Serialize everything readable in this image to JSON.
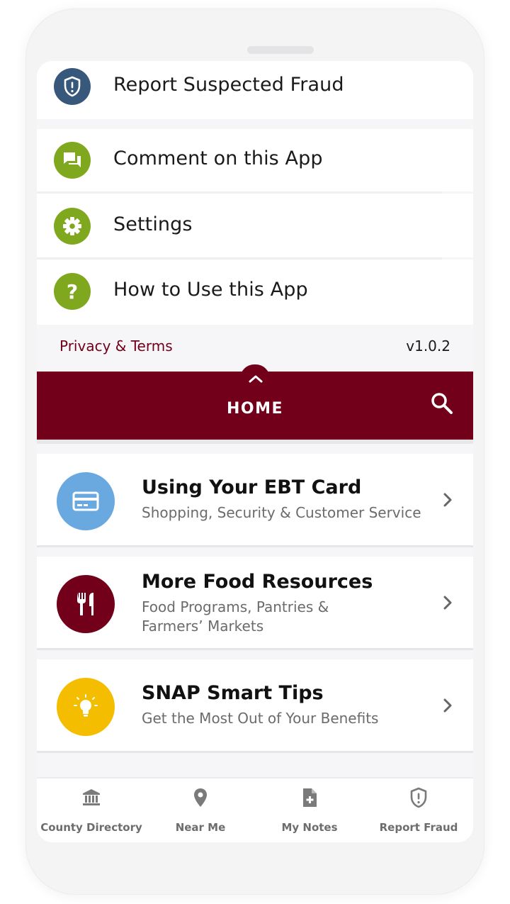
{
  "drawer": {
    "items": [
      {
        "label": "Report Suspected Fraud",
        "icon": "shield-alert-icon",
        "color": "#37587a"
      },
      {
        "label": "Comment on this App",
        "icon": "chat-icon",
        "color": "#7fa81e"
      },
      {
        "label": "Settings",
        "icon": "gear-icon",
        "color": "#7fa81e"
      },
      {
        "label": "How to Use this App",
        "icon": "question-icon",
        "color": "#7fa81e"
      }
    ],
    "privacy_label": "Privacy & Terms",
    "version": "v1.0.2"
  },
  "home_bar": {
    "title": "HOME",
    "color": "#72001a"
  },
  "cards": [
    {
      "title": "Using Your EBT Card",
      "subtitle": "Shopping, Security & Customer Service",
      "icon": "credit-card-icon",
      "color": "#6aa8e0"
    },
    {
      "title": "More Food Resources",
      "subtitle": "Food Programs, Pantries & Farmers’ Markets",
      "icon": "fork-knife-icon",
      "color": "#72001a"
    },
    {
      "title": "SNAP Smart Tips",
      "subtitle": "Get the Most Out of  Your Benefits",
      "icon": "lightbulb-icon",
      "color": "#f5bd00"
    }
  ],
  "bottom_nav": [
    {
      "label": "County Directory",
      "icon": "bank-icon"
    },
    {
      "label": "Near Me",
      "icon": "map-pin-icon"
    },
    {
      "label": "My Notes",
      "icon": "add-note-icon"
    },
    {
      "label": "Report Fraud",
      "icon": "shield-alert-icon"
    }
  ]
}
